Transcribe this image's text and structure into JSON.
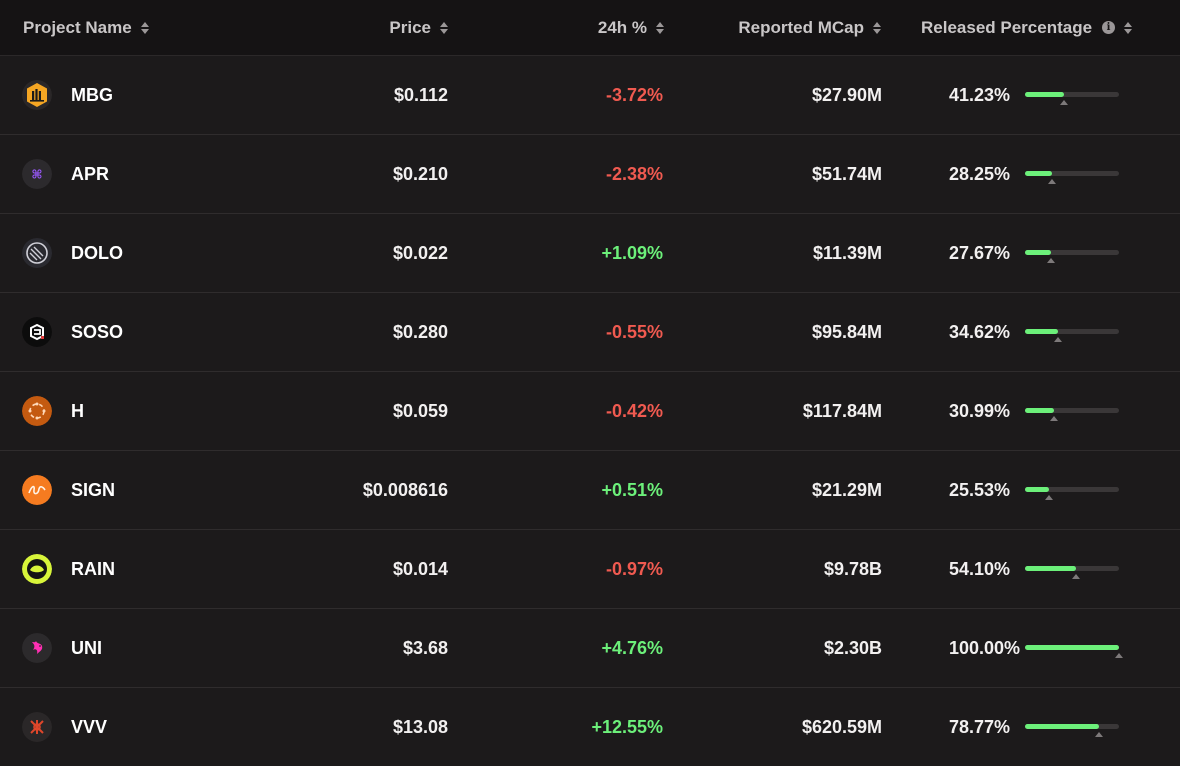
{
  "columns": {
    "project_name": "Project Name",
    "price": "Price",
    "change_24h": "24h %",
    "reported_mcap": "Reported MCap",
    "released_percentage": "Released Percentage",
    "info_icon": "i"
  },
  "colors": {
    "positive": "#6cf07a",
    "negative": "#f05a50",
    "bar_fill": "#6cf07a",
    "bar_track": "#3a3738"
  },
  "rows": [
    {
      "symbol": "MBG",
      "icon": "mbg-logo-icon",
      "price": "$0.112",
      "change": "-3.72%",
      "direction": "negative",
      "mcap": "$27.90M",
      "released": "41.23%",
      "released_value": 41.23
    },
    {
      "symbol": "APR",
      "icon": "apr-logo-icon",
      "price": "$0.210",
      "change": "-2.38%",
      "direction": "negative",
      "mcap": "$51.74M",
      "released": "28.25%",
      "released_value": 28.25
    },
    {
      "symbol": "DOLO",
      "icon": "dolo-logo-icon",
      "price": "$0.022",
      "change": "+1.09%",
      "direction": "positive",
      "mcap": "$11.39M",
      "released": "27.67%",
      "released_value": 27.67
    },
    {
      "symbol": "SOSO",
      "icon": "soso-logo-icon",
      "price": "$0.280",
      "change": "-0.55%",
      "direction": "negative",
      "mcap": "$95.84M",
      "released": "34.62%",
      "released_value": 34.62
    },
    {
      "symbol": "H",
      "icon": "h-logo-icon",
      "price": "$0.059",
      "change": "-0.42%",
      "direction": "negative",
      "mcap": "$117.84M",
      "released": "30.99%",
      "released_value": 30.99
    },
    {
      "symbol": "SIGN",
      "icon": "sign-logo-icon",
      "price": "$0.008616",
      "change": "+0.51%",
      "direction": "positive",
      "mcap": "$21.29M",
      "released": "25.53%",
      "released_value": 25.53
    },
    {
      "symbol": "RAIN",
      "icon": "rain-logo-icon",
      "price": "$0.014",
      "change": "-0.97%",
      "direction": "negative",
      "mcap": "$9.78B",
      "released": "54.10%",
      "released_value": 54.1
    },
    {
      "symbol": "UNI",
      "icon": "uni-logo-icon",
      "price": "$3.68",
      "change": "+4.76%",
      "direction": "positive",
      "mcap": "$2.30B",
      "released": "100.00%",
      "released_value": 100.0
    },
    {
      "symbol": "VVV",
      "icon": "vvv-logo-icon",
      "price": "$13.08",
      "change": "+12.55%",
      "direction": "positive",
      "mcap": "$620.59M",
      "released": "78.77%",
      "released_value": 78.77
    }
  ]
}
